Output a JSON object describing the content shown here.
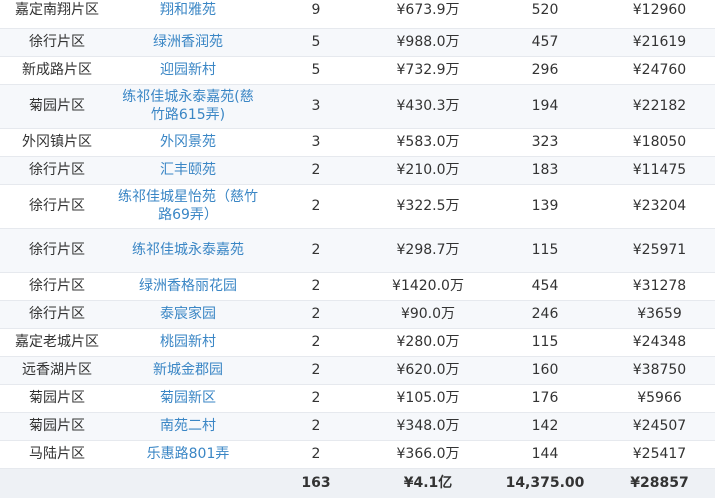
{
  "rows": [
    {
      "district": "嘉定南翔片区",
      "estate": "翔和雅苑",
      "count": "9",
      "total_price": "¥673.9万",
      "area": "520",
      "avg_price": "¥12960"
    },
    {
      "district": "徐行片区",
      "estate": "绿洲香润苑",
      "count": "5",
      "total_price": "¥988.0万",
      "area": "457",
      "avg_price": "¥21619"
    },
    {
      "district": "新成路片区",
      "estate": "迎园新村",
      "count": "5",
      "total_price": "¥732.9万",
      "area": "296",
      "avg_price": "¥24760"
    },
    {
      "district": "菊园片区",
      "estate": "练祁佳城永泰嘉苑(慈竹路615弄)",
      "count": "3",
      "total_price": "¥430.3万",
      "area": "194",
      "avg_price": "¥22182"
    },
    {
      "district": "外冈镇片区",
      "estate": "外冈景苑",
      "count": "3",
      "total_price": "¥583.0万",
      "area": "323",
      "avg_price": "¥18050"
    },
    {
      "district": "徐行片区",
      "estate": "汇丰颐苑",
      "count": "2",
      "total_price": "¥210.0万",
      "area": "183",
      "avg_price": "¥11475"
    },
    {
      "district": "徐行片区",
      "estate": "练祁佳城星怡苑（慈竹路69弄）",
      "count": "2",
      "total_price": "¥322.5万",
      "area": "139",
      "avg_price": "¥23204"
    },
    {
      "district": "徐行片区",
      "estate": "练祁佳城永泰嘉苑",
      "count": "2",
      "total_price": "¥298.7万",
      "area": "115",
      "avg_price": "¥25971"
    },
    {
      "district": "徐行片区",
      "estate": "绿洲香格丽花园",
      "count": "2",
      "total_price": "¥1420.0万",
      "area": "454",
      "avg_price": "¥31278"
    },
    {
      "district": "徐行片区",
      "estate": "泰宸家园",
      "count": "2",
      "total_price": "¥90.0万",
      "area": "246",
      "avg_price": "¥3659"
    },
    {
      "district": "嘉定老城片区",
      "estate": "桃园新村",
      "count": "2",
      "total_price": "¥280.0万",
      "area": "115",
      "avg_price": "¥24348"
    },
    {
      "district": "远香湖片区",
      "estate": "新城金郡园",
      "count": "2",
      "total_price": "¥620.0万",
      "area": "160",
      "avg_price": "¥38750"
    },
    {
      "district": "菊园片区",
      "estate": "菊园新区",
      "count": "2",
      "total_price": "¥105.0万",
      "area": "176",
      "avg_price": "¥5966"
    },
    {
      "district": "菊园片区",
      "estate": "南苑二村",
      "count": "2",
      "total_price": "¥348.0万",
      "area": "142",
      "avg_price": "¥24507"
    },
    {
      "district": "马陆片区",
      "estate": "乐惠路801弄",
      "count": "2",
      "total_price": "¥366.0万",
      "area": "144",
      "avg_price": "¥25417"
    }
  ],
  "totals": {
    "count": "163",
    "total_price": "¥4.1亿",
    "area": "14,375.00",
    "avg_price": "¥28857"
  }
}
